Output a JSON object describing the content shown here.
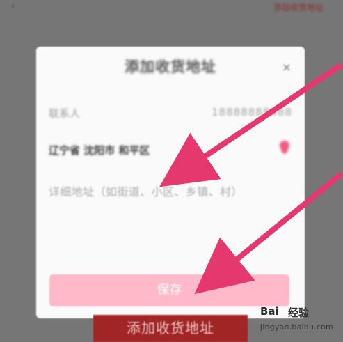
{
  "header": {
    "right_text": "添加收货地址"
  },
  "dialog": {
    "title": "添加收货地址",
    "contact_label": "联系人",
    "phone_value": "18888888888",
    "region_value": "辽宁省 沈阳市 和平区",
    "address_placeholder": "详细地址（如街道、小区、乡镇、村）",
    "save_label": "保存"
  },
  "bottom": {
    "add_label": "添加收货地址"
  },
  "watermark": {
    "logo": "Bai",
    "name": "经验",
    "url": "jingyan.baidu.com"
  },
  "colors": {
    "overlay": "#767676",
    "dialog_background": "#fafafa",
    "save_button": "#ffb9c8",
    "bottom_button": "#a22525",
    "arrow": "#e5386f"
  }
}
